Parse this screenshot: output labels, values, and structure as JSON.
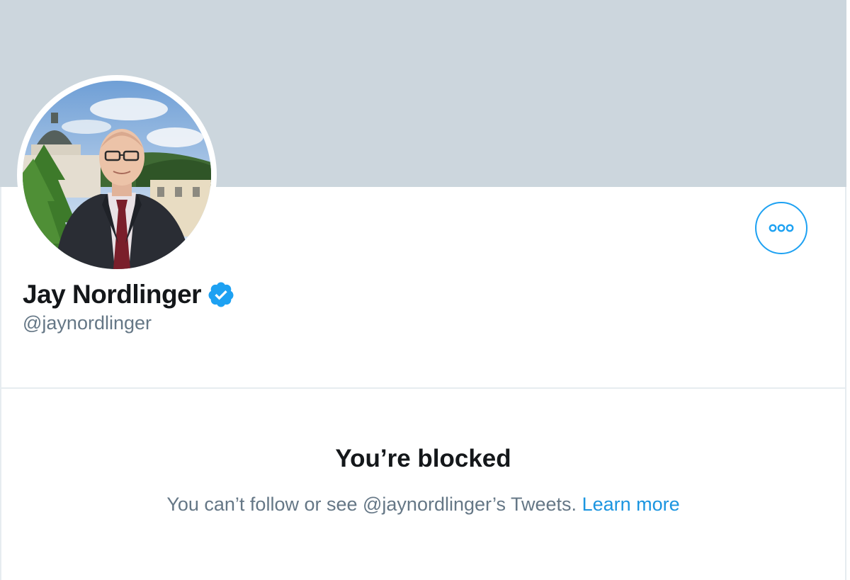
{
  "profile": {
    "display_name": "Jay Nordlinger",
    "handle": "@jaynordlinger",
    "verified": true,
    "banner_color": "#ccd6dd",
    "avatar": "profile-photo"
  },
  "actions": {
    "more_icon": "more-horizontal-icon",
    "accent_color": "#1da1f2"
  },
  "blocked": {
    "title": "You’re blocked",
    "message": "You can’t follow or see @jaynordlinger’s Tweets.",
    "learn_more": "Learn more"
  }
}
